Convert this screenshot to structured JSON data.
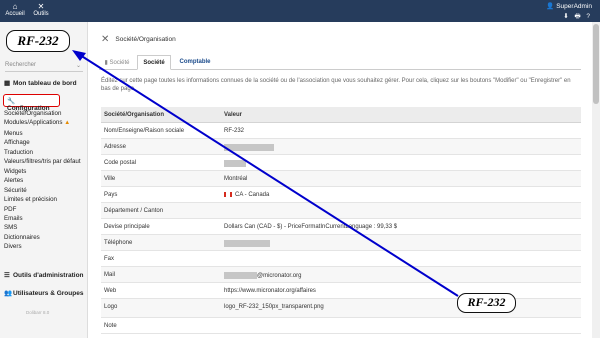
{
  "topbar": {
    "home_label": "Accueil",
    "tools_label": "Outils",
    "user_label": "SuperAdmin",
    "user_icons": "⬇ 🖶 ?"
  },
  "sidebar": {
    "logo_text": "RF-232",
    "search_placeholder": "Rechercher",
    "dashboard_label": "Mon tableau de bord",
    "configuration_label": "Configuration",
    "submenu": [
      "Société/Organisation",
      "Modules/Applications",
      "Menus",
      "Affichage",
      "Traduction",
      "Valeurs/filtres/tris par défaut",
      "Widgets",
      "Alertes",
      "Sécurité",
      "Limites et précision",
      "PDF",
      "Emails",
      "SMS",
      "Dictionnaires",
      "Divers"
    ],
    "admin_tools_label": "Outils d'administration",
    "users_groups_label": "Utilisateurs & Groupes",
    "version": "Dolibarr 8.0"
  },
  "main": {
    "page_title": "Société/Organisation",
    "tabs": [
      "Société",
      "Société",
      "Comptable"
    ],
    "description": "Éditez sur cette page toutes les informations connues de la société ou de l'association que vous souhaitez gérer. Pour cela, cliquez sur les boutons \"Modifier\" ou \"Enregistrer\" en bas de page.",
    "table": {
      "headers": [
        "Société/Organisation",
        "Valeur"
      ],
      "rows": [
        {
          "label": "Nom/Enseigne/Raison sociale",
          "value": "RF-232"
        },
        {
          "label": "Adresse",
          "value": ""
        },
        {
          "label": "Code postal",
          "value": ""
        },
        {
          "label": "Ville",
          "value": "Montréal"
        },
        {
          "label": "Pays",
          "value": "CA - Canada"
        },
        {
          "label": "Département / Canton",
          "value": ""
        },
        {
          "label": "Devise principale",
          "value": "Dollars Can  (CAD - $) - PriceFormatInCurrentLanguage : 99,33 $"
        },
        {
          "label": "Téléphone",
          "value": ""
        },
        {
          "label": "Fax",
          "value": ""
        },
        {
          "label": "Mail",
          "value": "@micronator.org"
        },
        {
          "label": "Web",
          "value": "https://www.micronator.org/affaires"
        },
        {
          "label": "Logo",
          "value": "logo_RF-232_150px_transparent.png"
        },
        {
          "label": "Note",
          "value": ""
        }
      ]
    }
  },
  "callout_text": "RF-232",
  "colors": {
    "topbar": "#263c5c",
    "accent_link": "#1a4a8a",
    "highlight_border": "#dd0000",
    "arrow": "#0000cc"
  }
}
